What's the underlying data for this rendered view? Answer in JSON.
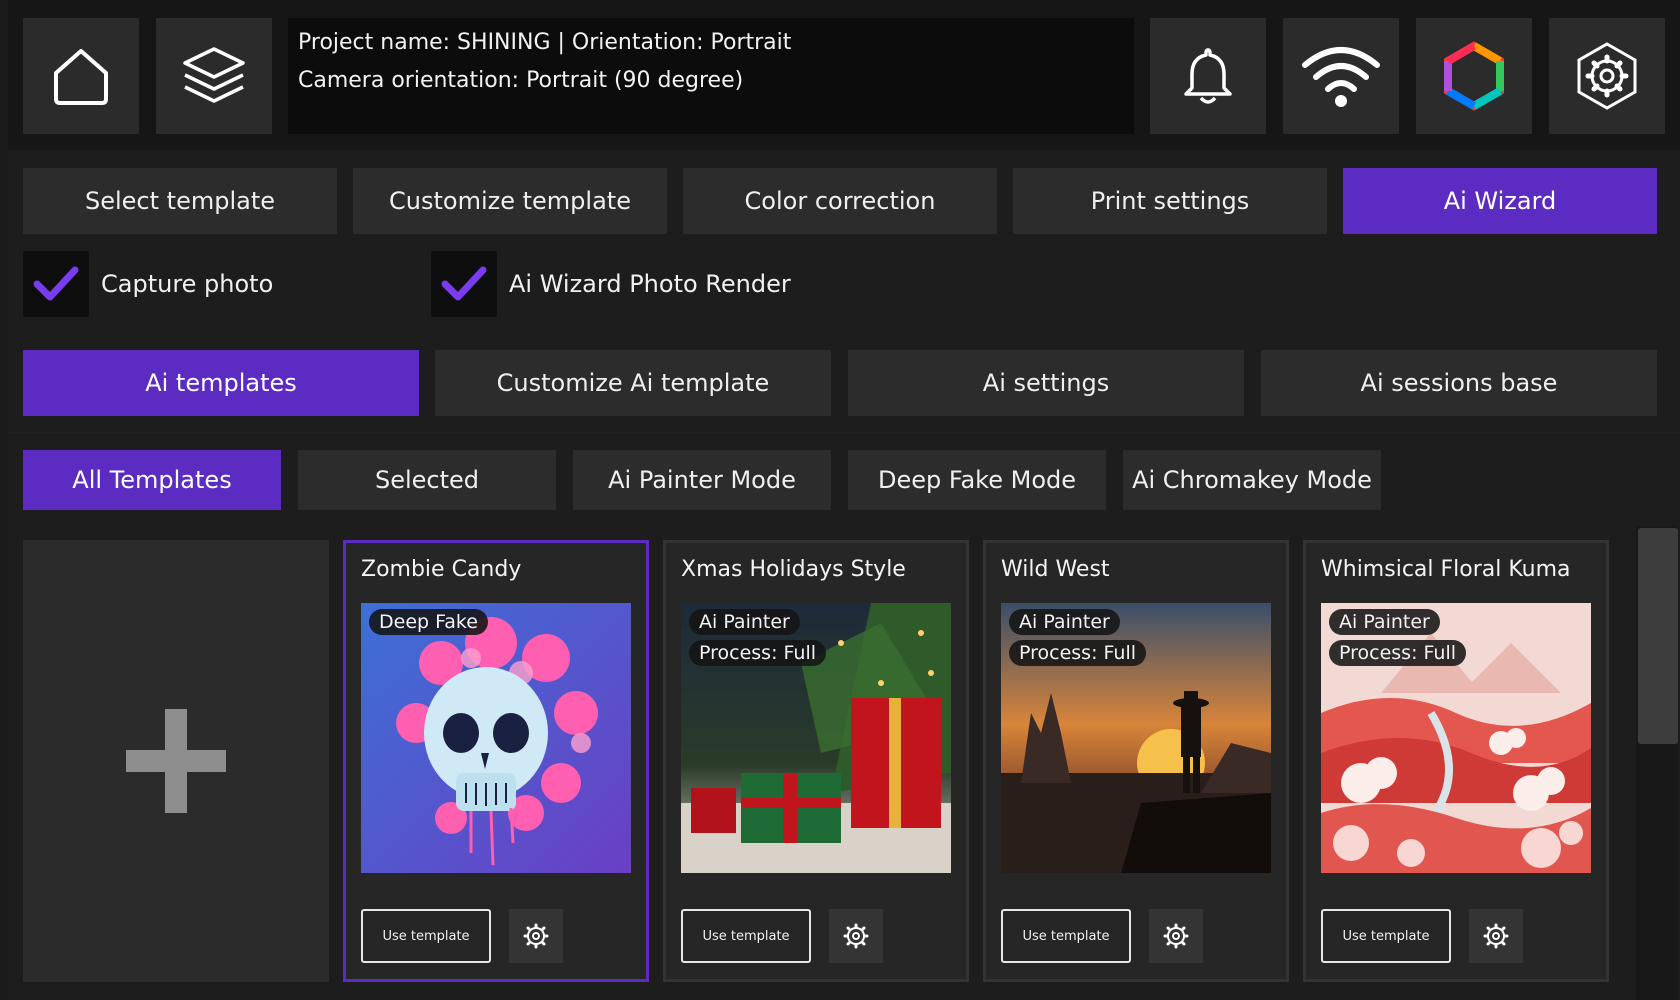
{
  "header": {
    "project_line": "Project name: SHINING | Orientation: Portrait",
    "camera_line": "Camera orientation: Portrait (90 degree)",
    "icons": [
      "home-icon",
      "layers-icon",
      "bell-icon",
      "wifi-icon",
      "color-hexagon-icon",
      "settings-gear-icon"
    ]
  },
  "main_tabs": [
    {
      "label": "Select template",
      "active": false
    },
    {
      "label": "Customize template",
      "active": false
    },
    {
      "label": "Color correction",
      "active": false
    },
    {
      "label": "Print settings",
      "active": false
    },
    {
      "label": "Ai Wizard",
      "active": true
    }
  ],
  "checks": [
    {
      "label": "Capture photo",
      "checked": true
    },
    {
      "label": "Ai Wizard Photo Render",
      "checked": true
    }
  ],
  "sub_tabs": [
    {
      "label": "Ai templates",
      "active": true
    },
    {
      "label": "Customize Ai template",
      "active": false
    },
    {
      "label": "Ai settings",
      "active": false
    },
    {
      "label": "Ai sessions base",
      "active": false
    }
  ],
  "filter_tabs": [
    {
      "label": "All Templates",
      "active": true
    },
    {
      "label": "Selected",
      "active": false
    },
    {
      "label": "Ai Painter Mode",
      "active": false
    },
    {
      "label": "Deep Fake Mode",
      "active": false
    },
    {
      "label": "Ai Chromakey Mode",
      "active": false
    }
  ],
  "templates": [
    {
      "title": "Zombie Candy",
      "badges": [
        "Deep Fake"
      ],
      "selected": true,
      "use_label": "Use template"
    },
    {
      "title": "Xmas Holidays Style",
      "badges": [
        "Ai Painter",
        "Process: Full"
      ],
      "selected": false,
      "use_label": "Use template"
    },
    {
      "title": "Wild West",
      "badges": [
        "Ai Painter",
        "Process: Full"
      ],
      "selected": false,
      "use_label": "Use template"
    },
    {
      "title": "Whimsical Floral Kuma",
      "badges": [
        "Ai Painter",
        "Process: Full"
      ],
      "selected": false,
      "use_label": "Use template"
    }
  ],
  "colors": {
    "accent": "#5b2bc2",
    "check_mark": "#7a3cf0",
    "tab_bg": "#2c2c2c"
  }
}
